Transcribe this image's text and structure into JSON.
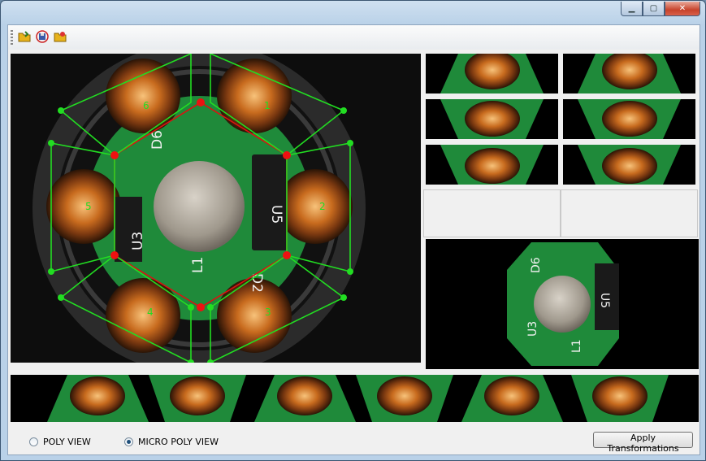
{
  "window": {
    "minimize_icon": "minimize-icon",
    "maximize_icon": "maximize-icon",
    "close_icon": "close-icon"
  },
  "toolbar": {
    "icons": [
      "open-folder-icon",
      "save-disk-icon",
      "load-folder-icon"
    ]
  },
  "main_view": {
    "image": "pcb-board-hexagonal-coil-grid",
    "hexagon_labels": [
      "6",
      "1",
      "5",
      "2",
      "4",
      "3"
    ],
    "component_labels": [
      "D6",
      "U3",
      "L1",
      "U5",
      "D2"
    ]
  },
  "preview": {
    "component_labels": [
      "D6",
      "U3",
      "L1",
      "U5"
    ]
  },
  "options": {
    "poly_view_label": "POLY VIEW",
    "micro_poly_view_label": "MICRO POLY VIEW",
    "selected": "micro_poly_view"
  },
  "actions": {
    "apply_label": "Apply Transformations"
  },
  "colors": {
    "hex_outline": "#22dd22",
    "inner_hex": "#dd1111",
    "board": "#1f8a3a"
  }
}
